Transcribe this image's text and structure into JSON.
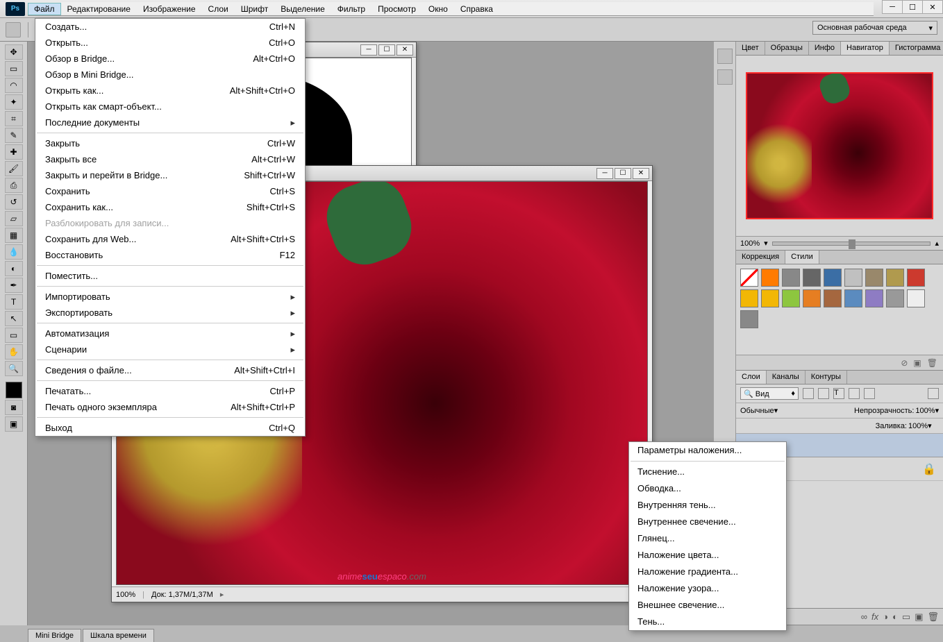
{
  "app": {
    "logo": "Ps"
  },
  "menubar": [
    "Файл",
    "Редактирование",
    "Изображение",
    "Слои",
    "Шрифт",
    "Выделение",
    "Фильтр",
    "Просмотр",
    "Окно",
    "Справка"
  ],
  "workspace_selector": "Основная рабочая среда",
  "file_menu": [
    {
      "label": "Создать...",
      "shortcut": "Ctrl+N"
    },
    {
      "label": "Открыть...",
      "shortcut": "Ctrl+O"
    },
    {
      "label": "Обзор в Bridge...",
      "shortcut": "Alt+Ctrl+O"
    },
    {
      "label": "Обзор в Mini Bridge...",
      "shortcut": ""
    },
    {
      "label": "Открыть как...",
      "shortcut": "Alt+Shift+Ctrl+O"
    },
    {
      "label": "Открыть как смарт-объект...",
      "shortcut": ""
    },
    {
      "label": "Последние документы",
      "shortcut": "",
      "submenu": true
    },
    {
      "sep": true
    },
    {
      "label": "Закрыть",
      "shortcut": "Ctrl+W"
    },
    {
      "label": "Закрыть все",
      "shortcut": "Alt+Ctrl+W"
    },
    {
      "label": "Закрыть и перейти в Bridge...",
      "shortcut": "Shift+Ctrl+W"
    },
    {
      "label": "Сохранить",
      "shortcut": "Ctrl+S"
    },
    {
      "label": "Сохранить как...",
      "shortcut": "Shift+Ctrl+S"
    },
    {
      "label": "Разблокировать для записи...",
      "shortcut": "",
      "disabled": true
    },
    {
      "label": "Сохранить для Web...",
      "shortcut": "Alt+Shift+Ctrl+S"
    },
    {
      "label": "Восстановить",
      "shortcut": "F12"
    },
    {
      "sep": true
    },
    {
      "label": "Поместить...",
      "shortcut": ""
    },
    {
      "sep": true
    },
    {
      "label": "Импортировать",
      "shortcut": "",
      "submenu": true
    },
    {
      "label": "Экспортировать",
      "shortcut": "",
      "submenu": true
    },
    {
      "sep": true
    },
    {
      "label": "Автоматизация",
      "shortcut": "",
      "submenu": true
    },
    {
      "label": "Сценарии",
      "shortcut": "",
      "submenu": true
    },
    {
      "sep": true
    },
    {
      "label": "Сведения о файле...",
      "shortcut": "Alt+Shift+Ctrl+I"
    },
    {
      "sep": true
    },
    {
      "label": "Печатать...",
      "shortcut": "Ctrl+P"
    },
    {
      "label": "Печать одного экземпляра",
      "shortcut": "Alt+Shift+Ctrl+P"
    },
    {
      "sep": true
    },
    {
      "label": "Выход",
      "shortcut": "Ctrl+Q"
    }
  ],
  "fx_menu": [
    "Параметры наложения...",
    "-",
    "Тиснение...",
    "Обводка...",
    "Внутренняя тень...",
    "Внутреннее свечение...",
    "Глянец...",
    "Наложение цвета...",
    "Наложение градиента...",
    "Наложение узора...",
    "Внешнее свечение...",
    "Тень..."
  ],
  "doc": {
    "zoom": "100%",
    "status": "Док: 1,37M/1,37M",
    "watermark1": "anime",
    "watermark2": "seu",
    "watermark3": "espaco",
    "watermark4": ".com"
  },
  "panels": {
    "group1_tabs": [
      "Цвет",
      "Образцы",
      "Инфо",
      "Навигатор",
      "Гистограмма"
    ],
    "navigator_zoom": "100%",
    "group2_tabs": [
      "Коррекция",
      "Стили"
    ],
    "group3_tabs": [
      "Слои",
      "Каналы",
      "Контуры"
    ],
    "layers": {
      "filter": "Вид",
      "blend": "Обычные",
      "opacity_label": "Непрозрачность:",
      "opacity_value": "100%",
      "fill_label": "Заливка:",
      "fill_value": "100%"
    }
  },
  "bottom_tabs": [
    "Mini Bridge",
    "Шкала времени"
  ],
  "style_colors": [
    "#ffffff",
    "#ff7b00",
    "#888888",
    "#666666",
    "#3b6ea5",
    "#c0c0c0",
    "#99886b",
    "#b09a4e",
    "#cc3a2e",
    "#f2b705",
    "#f2b705",
    "#8dc63f",
    "#e67e22",
    "#a5673f",
    "#5b8bbf",
    "#8e7cc3",
    "#999999",
    "#eeeeee",
    "#888888"
  ]
}
